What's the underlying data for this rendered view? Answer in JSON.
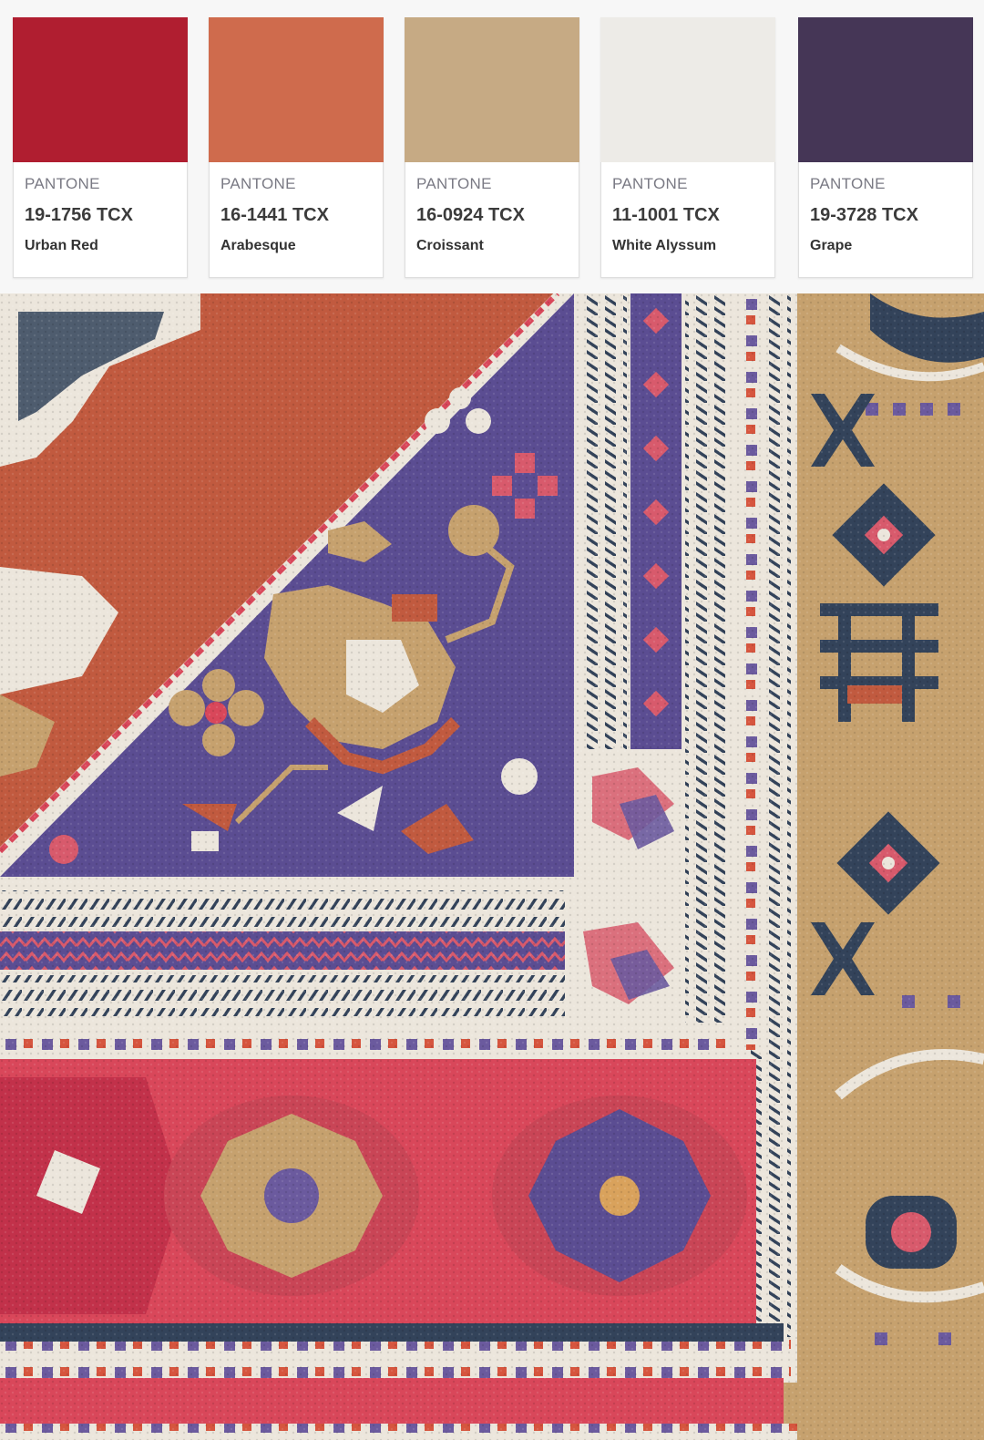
{
  "swatches": [
    {
      "brand": "PANTONE",
      "code": "19-1756 TCX",
      "name": "Urban Red",
      "color": "#b01e30"
    },
    {
      "brand": "PANTONE",
      "code": "16-1441 TCX",
      "name": "Arabesque",
      "color": "#cf6b4d"
    },
    {
      "brand": "PANTONE",
      "code": "16-0924 TCX",
      "name": "Croissant",
      "color": "#c6aa84"
    },
    {
      "brand": "PANTONE",
      "code": "11-1001 TCX",
      "name": "White Alyssum",
      "color": "#edebe7"
    },
    {
      "brand": "PANTONE",
      "code": "19-3728 TCX",
      "name": "Grape",
      "color": "#453656"
    }
  ],
  "photo": {
    "icon": "rug-photo",
    "colors": {
      "rust": "#c15a3f",
      "purple": "#5b4d92",
      "navy": "#33435a",
      "cream": "#ece6dc",
      "red": "#d9475a",
      "tan": "#c6a16e",
      "pink": "#d85a6c"
    }
  }
}
